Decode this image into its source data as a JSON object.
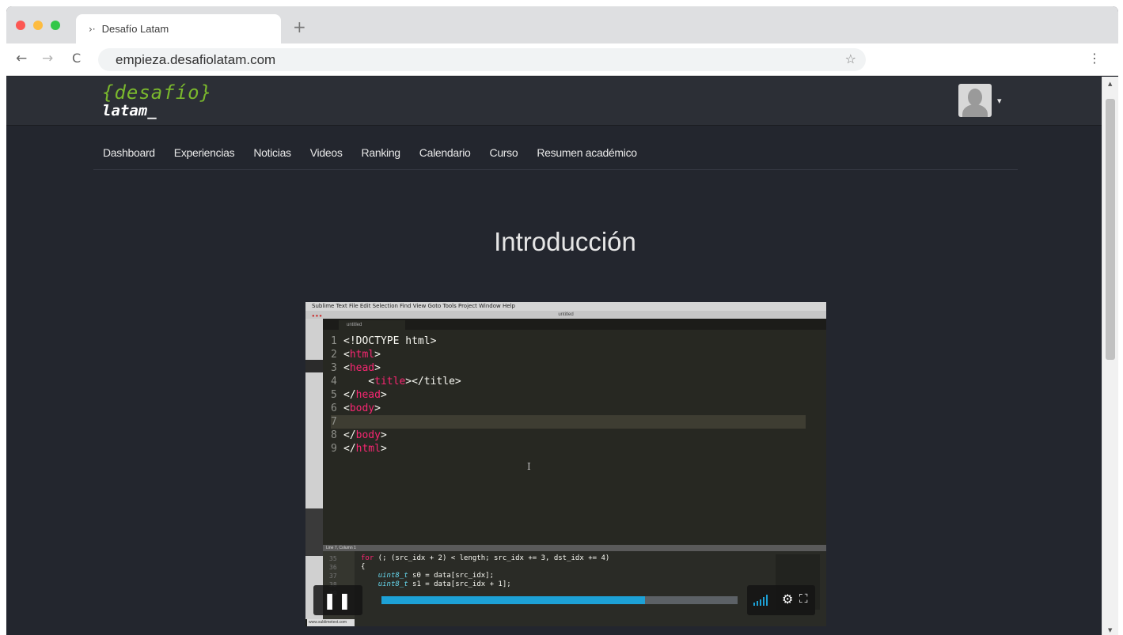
{
  "browser": {
    "tab_title": "Desafío Latam",
    "tab_icon": "desafio-favicon",
    "new_tab_label": "+",
    "url": "empieza.desafiolatam.com",
    "back_glyph": "←",
    "forward_glyph": "→",
    "reload_glyph": "C",
    "bookmark_glyph": "☆",
    "menu_glyph": "⋮"
  },
  "site": {
    "logo_top": "{desafío}",
    "logo_bottom": "latam_",
    "avatar_caret": "▾",
    "nav": [
      {
        "label": "Dashboard"
      },
      {
        "label": "Experiencias"
      },
      {
        "label": "Noticias"
      },
      {
        "label": "Videos"
      },
      {
        "label": "Ranking"
      },
      {
        "label": "Calendario"
      },
      {
        "label": "Curso"
      },
      {
        "label": "Resumen académico"
      }
    ],
    "page_title": "Introducción"
  },
  "video": {
    "mac_menu": "Sublime Text   File   Edit   Selection   Find   View   Goto   Tools   Project   Window   Help",
    "window_title": "untitled",
    "editor_tab": "untitled",
    "status_line": "Line 7, Column 1",
    "progress_fraction": 0.74,
    "pause_glyph": "❚❚",
    "gear_glyph": "⚙",
    "fullscreen_glyph": "⛶",
    "source_url": "www.sublimetext.com",
    "code_lines": [
      {
        "n": "1",
        "pre": "<!DOCTYPE html>",
        "tag": "",
        "post": ""
      },
      {
        "n": "2",
        "pre": "<",
        "tag": "html",
        "post": ">"
      },
      {
        "n": "3",
        "pre": "<",
        "tag": "head",
        "post": ">"
      },
      {
        "n": "4",
        "pre": "    <",
        "tag": "title",
        "post": "></title>"
      },
      {
        "n": "5",
        "pre": "</",
        "tag": "head",
        "post": ">"
      },
      {
        "n": "6",
        "pre": "<",
        "tag": "body",
        "post": ">"
      },
      {
        "n": "7",
        "pre": "",
        "tag": "",
        "post": ""
      },
      {
        "n": "8",
        "pre": "</",
        "tag": "body",
        "post": ">"
      },
      {
        "n": "9",
        "pre": "</",
        "tag": "html",
        "post": ">"
      }
    ],
    "bottom_code": {
      "gutter": "35\n36\n37\n38\n39",
      "line1_kw": "for",
      "line1_rest": " (; (src_idx + 2) < length; src_idx += 3, dst_idx += 4)",
      "line2": "{",
      "line3_type": "uint8_t",
      "line3_rest": " s0 = data[src_idx];",
      "line4_type": "uint8_t",
      "line4_rest": " s1 = data[src_idx + 1];"
    }
  },
  "colors": {
    "page_bg": "#23262e",
    "header_bg": "#2c2f36",
    "logo_green": "#7ab82d",
    "progress_blue": "#1da1d6",
    "html_tag": "#f92672"
  }
}
